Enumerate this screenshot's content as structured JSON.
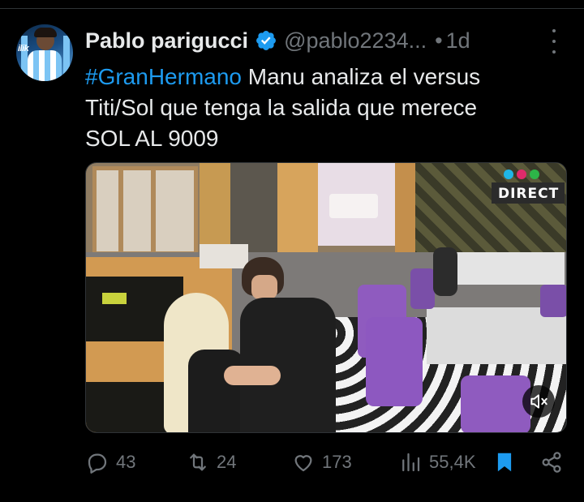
{
  "tweet": {
    "author_name": "Pablo parigucci",
    "handle": "@pablo2234...",
    "separator": "•",
    "time": "1d",
    "avatar_text": "ilik",
    "text_hashtag": "#GranHermano",
    "text_line1_rest": " Manu analiza el versus",
    "text_line2": "Titi/Sol que tenga la salida que merece",
    "text_line3": "SOL AL 9009"
  },
  "media": {
    "channel_badge": "DIRECT",
    "mute_icon": "volume-muted-icon"
  },
  "actions": {
    "replies": "43",
    "reposts": "24",
    "likes": "173",
    "views": "55,4K"
  },
  "colors": {
    "background": "#000000",
    "text": "#e7e9ea",
    "muted": "#71767b",
    "accent": "#1d9bf0"
  }
}
